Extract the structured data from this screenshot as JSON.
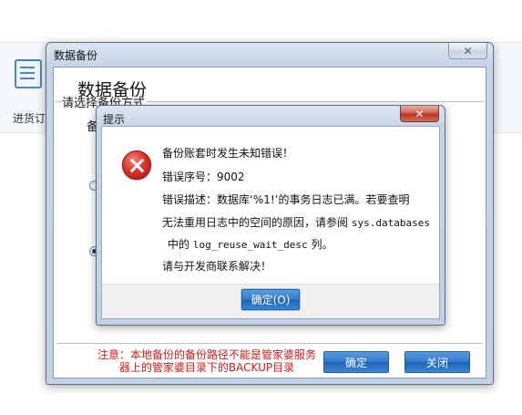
{
  "background": {
    "module_label": "进货订",
    "module_icon": "document-grid-icon"
  },
  "backup_dialog": {
    "title": "数据备份",
    "heading": "数据备份",
    "method_label": "请选择备份方式",
    "group_label": "备",
    "note": "注意：本地备份的备份路径不能是管家婆服务器上的管家婆目录下的BACKUP目录",
    "ok_label": "确定",
    "close_label": "关闭",
    "close_glyph": "✕",
    "note_color": "#d01c1c"
  },
  "error_dialog": {
    "title": "提示",
    "close_glyph": "✕",
    "icon": "error-icon",
    "line1": "备份账套时发生未知错误！",
    "line2": "错误序号：9002",
    "line3": "错误描述：数据库‘%1!’的事务日志已满。若要查明",
    "line4_text": "无法重用日志中的空间的原因，请参阅",
    "line4_code": "sys.databases",
    "line5_text_a": "中的",
    "line5_code": "log_reuse_wait_desc",
    "line5_text_b": "列。",
    "line6": "请与开发商联系解决！",
    "ok_label": "确定(O)"
  }
}
